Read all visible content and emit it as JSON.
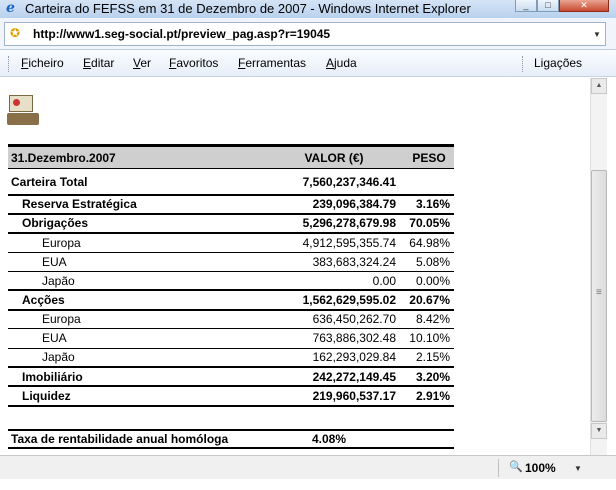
{
  "window": {
    "title": "Carteira do FEFSS em 31 de Dezembro de 2007 - Windows Internet Explorer",
    "controls": {
      "minimize": "_",
      "maximize": "□",
      "close": "✕"
    }
  },
  "address": {
    "url": "http://www1.seg-social.pt/preview_pag.asp?r=19045"
  },
  "menu": {
    "items": [
      "Ficheiro",
      "Editar",
      "Ver",
      "Favoritos",
      "Ferramentas",
      "Ajuda"
    ],
    "links": "Ligações"
  },
  "table": {
    "header": {
      "label": "31.Dezembro.2007",
      "value": "VALOR (€)",
      "peso": "PESO"
    },
    "total": {
      "label": "Carteira Total",
      "value": "7,560,237,346.41",
      "peso": ""
    },
    "rows": [
      {
        "label": "Reserva Estratégica",
        "value": "239,096,384.79",
        "peso": "3.16%"
      },
      {
        "label": "Obrigações",
        "value": "5,296,278,679.98",
        "peso": "70.05%"
      },
      {
        "label": "Europa",
        "value": "4,912,595,355.74",
        "peso": "64.98%"
      },
      {
        "label": "EUA",
        "value": "383,683,324.24",
        "peso": "5.08%"
      },
      {
        "label": "Japão",
        "value": "0.00",
        "peso": "0.00%"
      },
      {
        "label": "Acções",
        "value": "1,562,629,595.02",
        "peso": "20.67%"
      },
      {
        "label": "Europa",
        "value": "636,450,262.70",
        "peso": "8.42%"
      },
      {
        "label": "EUA",
        "value": "763,886,302.48",
        "peso": "10.10%"
      },
      {
        "label": "Japão",
        "value": "162,293,029.84",
        "peso": "2.15%"
      },
      {
        "label": "Imobiliário",
        "value": "242,272,149.45",
        "peso": "3.20%"
      },
      {
        "label": "Liquidez",
        "value": "219,960,537.17",
        "peso": "2.91%"
      }
    ],
    "rate": {
      "label": "Taxa de rentabilidade anual homóloga",
      "value": "4.08%"
    }
  },
  "status": {
    "zoom": "100%"
  }
}
